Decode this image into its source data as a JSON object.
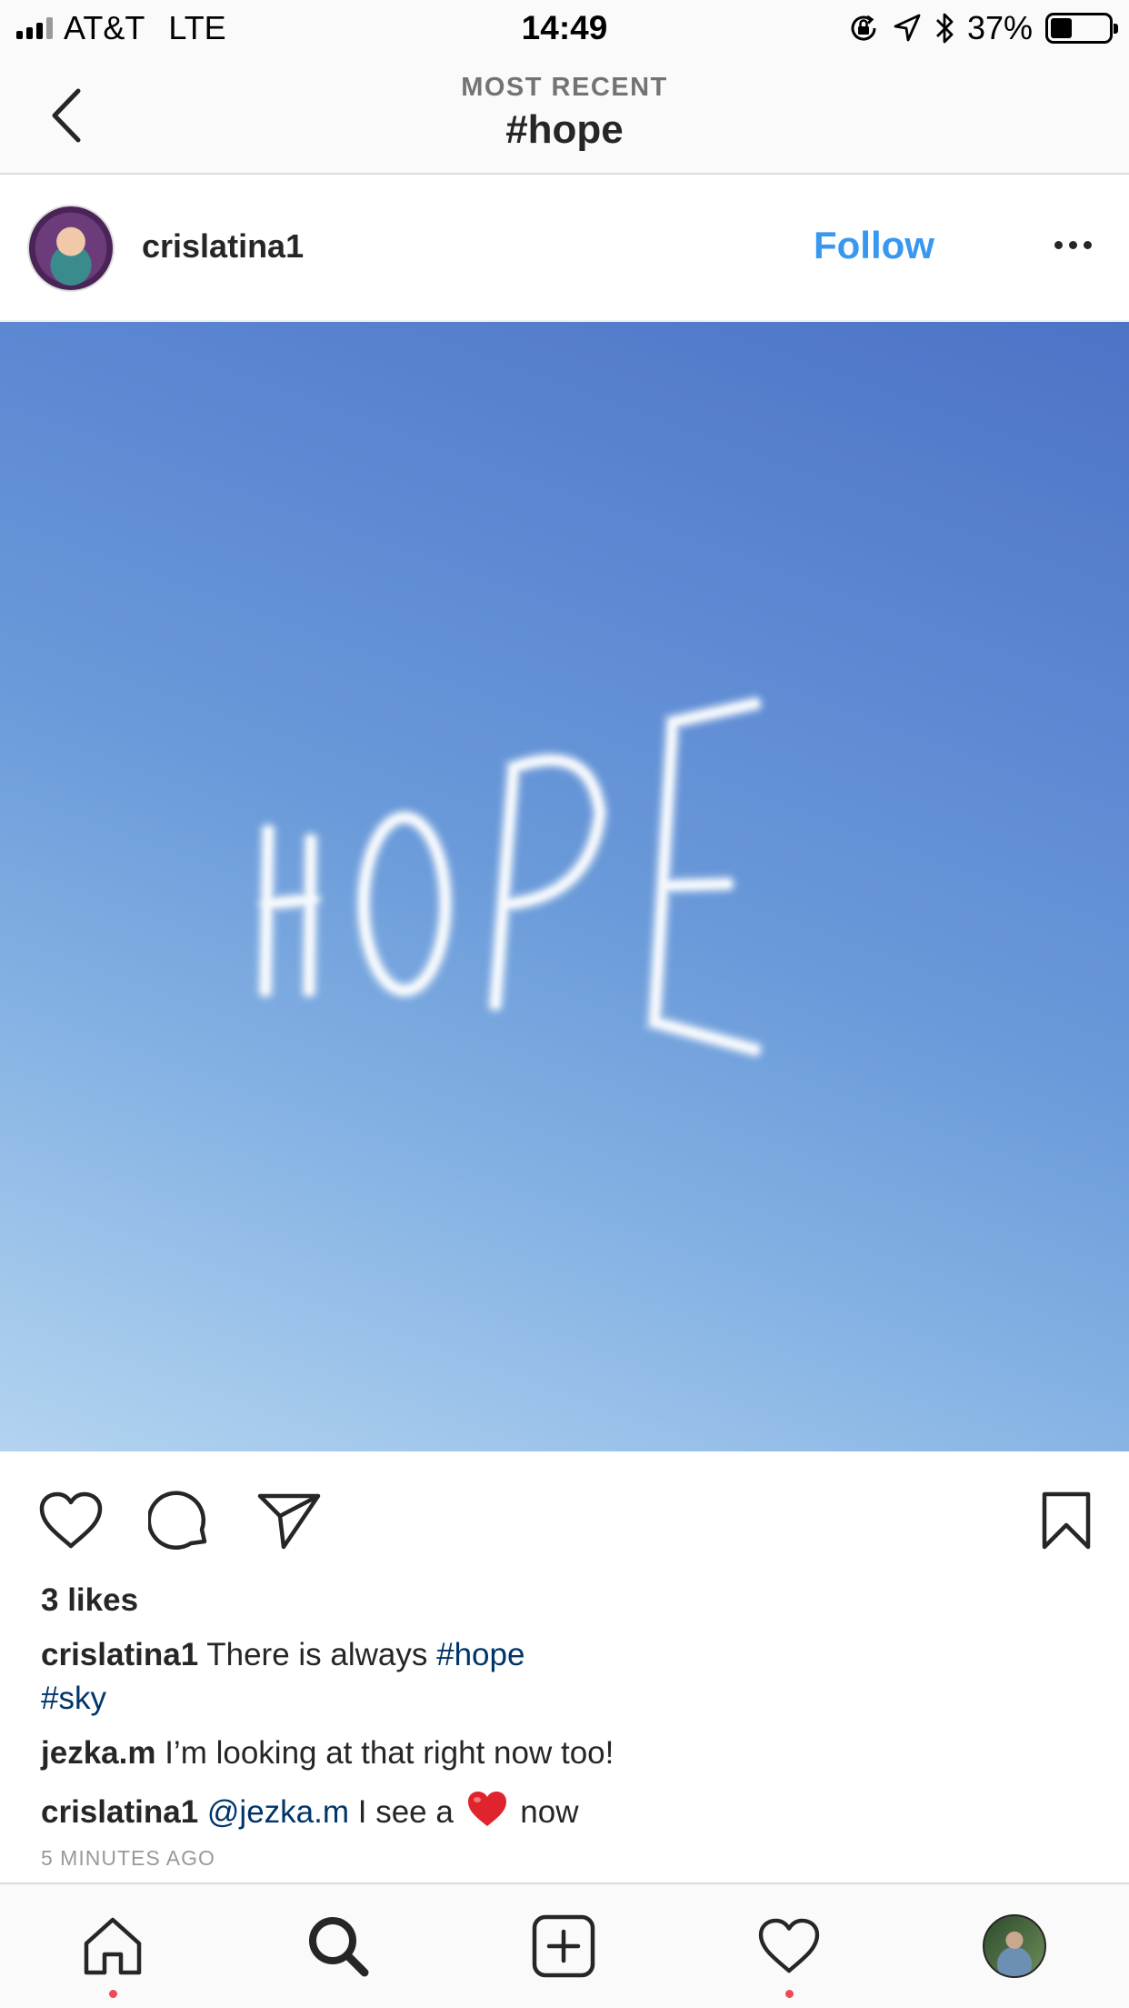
{
  "status_bar": {
    "carrier": "AT&T",
    "network": "LTE",
    "time": "14:49",
    "battery_percent": "37%",
    "battery_level": 0.37,
    "icons": [
      "orientation-lock-icon",
      "location-arrow-icon",
      "bluetooth-icon"
    ]
  },
  "nav": {
    "subtitle": "MOST RECENT",
    "title": "#hope",
    "back_icon": "chevron-left-icon"
  },
  "post": {
    "username": "crislatina1",
    "follow_label": "Follow",
    "more_icon": "ellipsis-icon",
    "image_text": "HOPE",
    "actions": [
      "heart-icon",
      "comment-icon",
      "share-icon",
      "bookmark-icon"
    ],
    "likes": "3 likes",
    "comments": [
      {
        "user": "crislatina1",
        "text": "There is always ",
        "tag": "#hope",
        "tag2": "#sky"
      },
      {
        "user": "jezka.m",
        "text": "I’m looking at that right now too!"
      },
      {
        "user": "crislatina1",
        "mention": "@jezka.m",
        "text_before": " I see a ",
        "text_after": " now"
      }
    ],
    "time_ago": "5 MINUTES AGO"
  },
  "tabbar": {
    "items": [
      "home-icon",
      "search-icon",
      "add-post-icon",
      "activity-heart-icon",
      "profile-avatar"
    ]
  },
  "colors": {
    "accent": "#3897f0",
    "hashtag": "#003569",
    "notification_dot": "#ed4956",
    "emoji_heart": "#e0242e"
  }
}
